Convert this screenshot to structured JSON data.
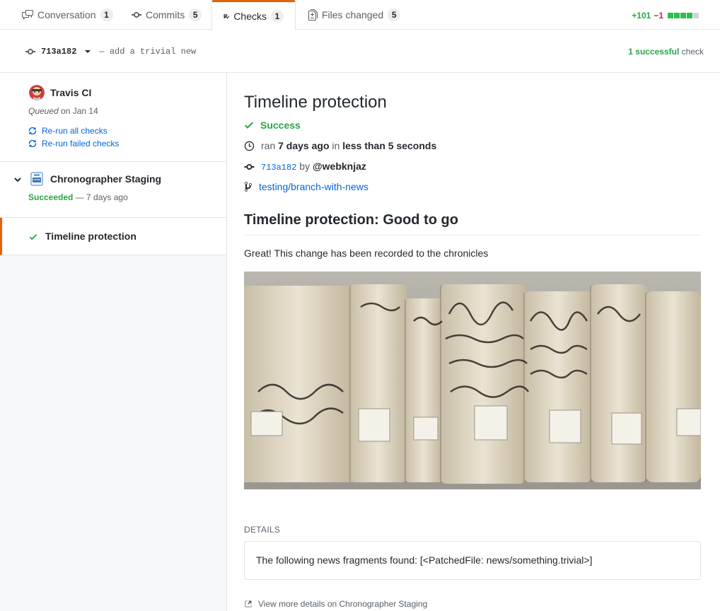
{
  "tabs": [
    {
      "label": "Conversation",
      "count": "1",
      "icon": "comment-discussion-icon"
    },
    {
      "label": "Commits",
      "count": "5",
      "icon": "git-commit-icon"
    },
    {
      "label": "Checks",
      "count": "1",
      "icon": "checklist-icon",
      "selected": true
    },
    {
      "label": "Files changed",
      "count": "5",
      "icon": "file-diff-icon"
    }
  ],
  "diffstat": {
    "additions": "+101",
    "deletions": "−1",
    "blocks": [
      "green",
      "green",
      "green",
      "green",
      "gray"
    ]
  },
  "commit": {
    "sha": "713a182",
    "message": "— add a trivial new",
    "summary_count": "1 successful",
    "summary_suffix": " check"
  },
  "sidebar": {
    "suites": [
      {
        "app": "Travis CI",
        "status_italic": "Queued",
        "status_rest": " on Jan 14",
        "actions": [
          "Re-run all checks",
          "Re-run failed checks"
        ]
      },
      {
        "app": "Chronographer Staging",
        "status_ok": "Succeeded",
        "status_rest": " — 7 days ago",
        "runs": [
          {
            "name": "Timeline protection",
            "status": "success"
          }
        ]
      }
    ]
  },
  "main": {
    "title": "Timeline protection",
    "status": "Success",
    "ran_prefix": "ran ",
    "ran_when": "7 days ago",
    "ran_in": " in ",
    "ran_duration": "less than 5 seconds",
    "commit_sha": "713a182",
    "by": " by ",
    "author": "@webknjaz",
    "branch": "testing/branch-with-news",
    "heading": "Timeline protection: Good to go",
    "paragraph": "Great! This change has been recorded to the chronicles",
    "image_alt": "Row of old archive volumes labelled Sess 25, Positiones 214–220",
    "details_label": "DETAILS",
    "details_text": "The following news fragments found: [<PatchedFile: news/something.trivial>]",
    "view_more": "View more details on Chronographer Staging"
  },
  "colors": {
    "accent": "#e36209",
    "success": "#28a745",
    "link": "#0366d6",
    "danger": "#cb2431"
  }
}
